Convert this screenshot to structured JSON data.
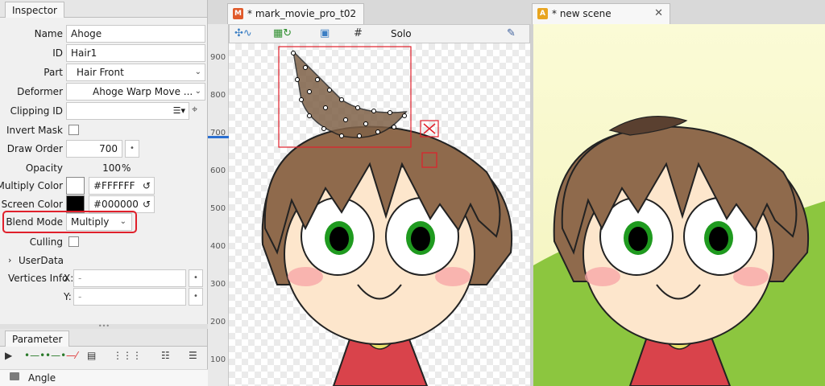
{
  "inspector": {
    "tab_title": "Inspector",
    "labels": {
      "name": "Name",
      "id": "ID",
      "part": "Part",
      "deformer": "Deformer",
      "clipping_id": "Clipping ID",
      "invert_mask": "Invert Mask",
      "draw_order": "Draw Order",
      "opacity": "Opacity",
      "multiply_color": "Multiply Color",
      "screen_color": "Screen Color",
      "blend_mode": "Blend Mode",
      "culling": "Culling",
      "user_data": "UserData",
      "vertices_info": "Vertices Info",
      "x": "X:",
      "y": "Y:"
    },
    "values": {
      "name": "Ahoge",
      "id": "Hair1",
      "part": "Hair Front",
      "deformer": "Ahoge Warp Move ...",
      "clipping_id": "",
      "invert_mask": false,
      "draw_order": "700",
      "opacity": "100",
      "opacity_unit": "%",
      "multiply_color": "#FFFFFF",
      "screen_color": "#000000",
      "blend_mode": "Multiply",
      "culling": false,
      "vertex_x": "-",
      "vertex_y": "-"
    }
  },
  "parameter": {
    "tab_title": "Parameter",
    "items": [
      {
        "label": "Angle"
      }
    ]
  },
  "editor": {
    "tabs": [
      {
        "label": "* mark_movie_pro_t02",
        "icon": "M"
      },
      {
        "label": "* new scene",
        "icon": "A"
      }
    ],
    "toolbar": {
      "solo_label": "Solo"
    },
    "ruler_ticks": [
      "900",
      "800",
      "700",
      "600",
      "500",
      "400",
      "300",
      "200",
      "100"
    ]
  },
  "colors": {
    "hair": "#8f6a4c",
    "ahoge": "#806248",
    "skin": "#fde6cc",
    "iris": "#1f9a1f",
    "hoodie": "#d9434b",
    "selection": "#e0202b",
    "grass": "#8cc63f"
  }
}
